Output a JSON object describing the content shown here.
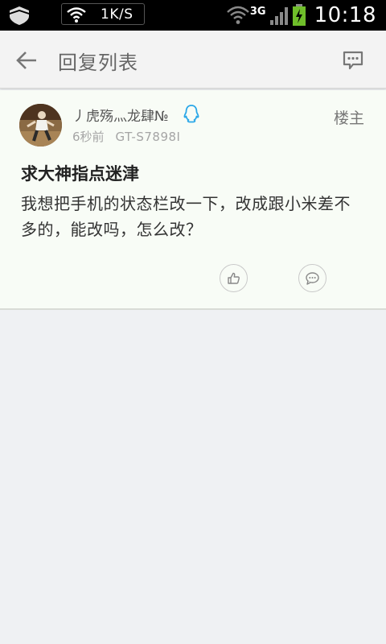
{
  "status_bar": {
    "speed": "1K/S",
    "network": "3G",
    "time": "10:18"
  },
  "app_bar": {
    "title": "回复列表"
  },
  "post": {
    "username": "丿虎殇灬龙肆№",
    "time_ago": "6秒前",
    "device": "GT-S7898I",
    "floor_label": "楼主",
    "title": "求大神指点迷津",
    "body": "我想把手机的状态栏改一下，改成跟小米差不多的，能改吗，怎么改？"
  },
  "colors": {
    "status_bar_bg": "#000000",
    "app_bar_bg": "#f3f3f3",
    "card_bg": "#f8fcf6",
    "page_bg": "#eff1f3",
    "qq_blue": "#2aa7e8",
    "charging_green": "#6fbe2a"
  },
  "icons": {
    "back": "arrow-left-icon",
    "message": "chat-bubble-icon",
    "qq": "qq-penguin-icon",
    "like": "thumbs-up-icon",
    "reply": "comment-icon"
  }
}
